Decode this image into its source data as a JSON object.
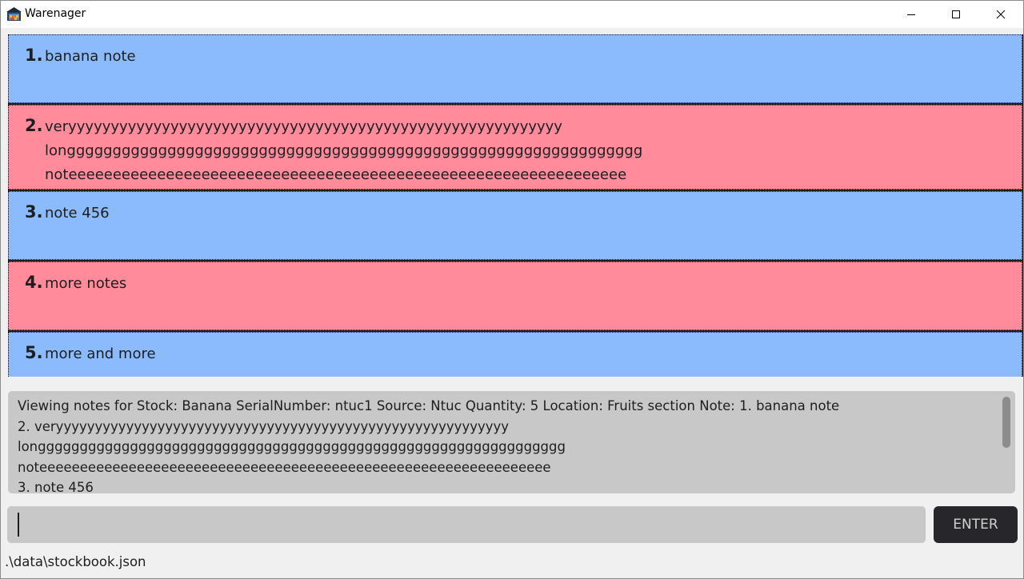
{
  "window": {
    "title": "Warenager",
    "icon": "warehouse-icon",
    "controls": [
      "minimize-icon",
      "maximize-icon",
      "close-icon"
    ]
  },
  "notes": [
    {
      "number": "1.",
      "text": "banana note",
      "color": "#8bbbfd"
    },
    {
      "number": "2.",
      "text": "veryyyyyyyyyyyyyyyyyyyyyyyyyyyyyyyyyyyyyyyyyyyyyyyyyyyyyyyyyy\nlonggggggggggggggggggggggggggggggggggggggggggggggggggggggggggggggg\nnoteeeeeeeeeeeeeeeeeeeeeeeeeeeeeeeeeeeeeeeeeeeeeeeeeeeeeeeeeeeeeee",
      "color": "#ff8b9b"
    },
    {
      "number": "3.",
      "text": "note 456",
      "color": "#8bbbfd"
    },
    {
      "number": "4.",
      "text": "more notes",
      "color": "#ff8b9b"
    },
    {
      "number": "5.",
      "text": "more and more",
      "color": "#8bbbfd"
    }
  ],
  "result": {
    "text": "Viewing notes for Stock: Banana SerialNumber: ntuc1 Source: Ntuc Quantity: 5 Location: Fruits section Note: 1. banana note\n2. veryyyyyyyyyyyyyyyyyyyyyyyyyyyyyyyyyyyyyyyyyyyyyyyyyyyyyyyyyy\nlonggggggggggggggggggggggggggggggggggggggggggggggggggggggggggggggg\nnoteeeeeeeeeeeeeeeeeeeeeeeeeeeeeeeeeeeeeeeeeeeeeeeeeeeeeeeeeeeeeee\n3. note 456"
  },
  "command": {
    "value": "",
    "button_label": "ENTER"
  },
  "status": {
    "file_path": ".\\data\\stockbook.json"
  }
}
